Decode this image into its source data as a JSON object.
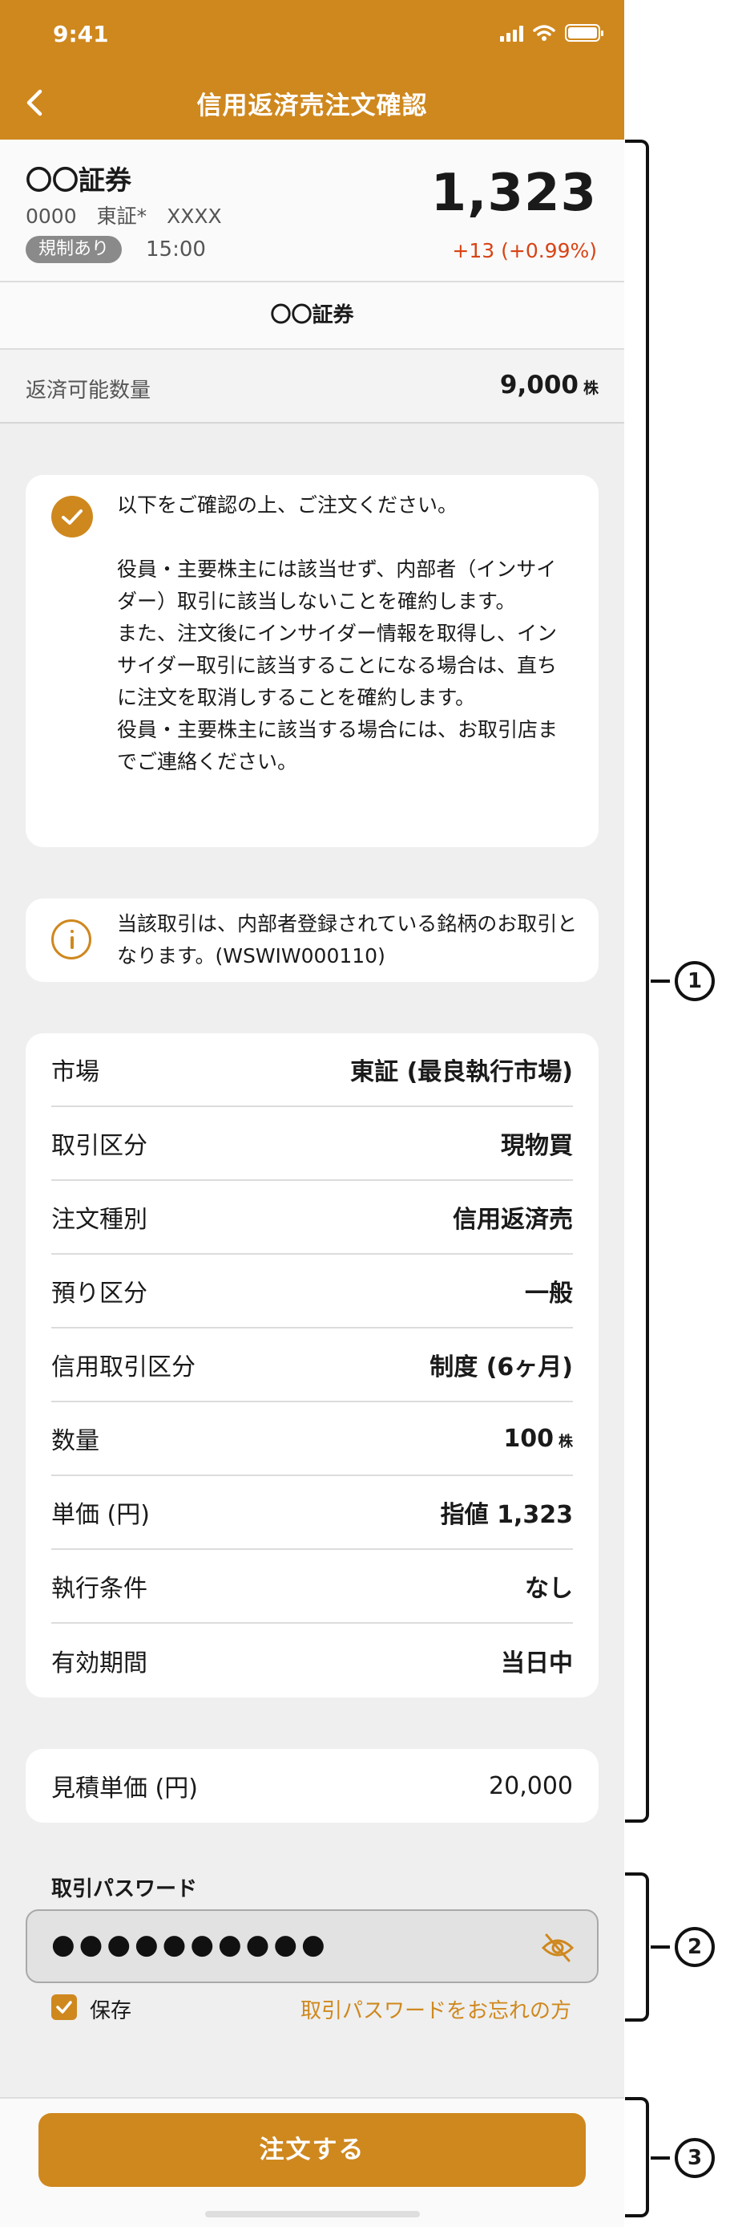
{
  "status_bar": {
    "time": "9:41"
  },
  "nav": {
    "title": "信用返済売注文確認"
  },
  "stock": {
    "name": "〇〇証券",
    "code_line": "0000　東証*　XXXX",
    "badge": "規制あり",
    "time": "15:00",
    "price": "1,323",
    "change": "+13 (+0.99%)"
  },
  "broker": {
    "name": "〇〇証券"
  },
  "available": {
    "label": "返済可能数量",
    "value": "9,000",
    "unit": "株"
  },
  "confirmation": {
    "text": "以下をご確認の上、ご注文ください。\n\n役員・主要株主には該当せず、内部者（インサイダー）取引に該当しないことを確約します。\nまた、注文後にインサイダー情報を取得し、インサイダー取引に該当することになる場合は、直ちに注文を取消しすることを確約します。\n役員・主要株主に該当する場合には、お取引店までご連絡ください。"
  },
  "notice": {
    "text": "当該取引は、内部者登録されている銘柄のお取引となります。(WSWIW000110)"
  },
  "details": [
    {
      "label": "市場",
      "value": "東証 (最良執行市場)"
    },
    {
      "label": "取引区分",
      "value": "現物買"
    },
    {
      "label": "注文種別",
      "value": "信用返済売"
    },
    {
      "label": "預り区分",
      "value": "一般"
    },
    {
      "label": "信用取引区分",
      "value": "制度 (6ヶ月)"
    },
    {
      "label": "数量",
      "value": "100",
      "unit": "株"
    },
    {
      "label": "単価 (円)",
      "value": "指値 1,323"
    },
    {
      "label": "執行条件",
      "value": "なし"
    },
    {
      "label": "有効期間",
      "value": "当日中"
    }
  ],
  "estimate": {
    "label": "見積単価 (円)",
    "value": "20,000"
  },
  "password": {
    "label": "取引パスワード",
    "masked": "●●●●●●●●●●",
    "save_label": "保存",
    "forgot_label": "取引パスワードをお忘れの方"
  },
  "order_button": {
    "label": "注文する"
  },
  "annotations": [
    "1",
    "2",
    "3"
  ],
  "colors": {
    "accent": "#cf881e",
    "change": "#d84315"
  }
}
